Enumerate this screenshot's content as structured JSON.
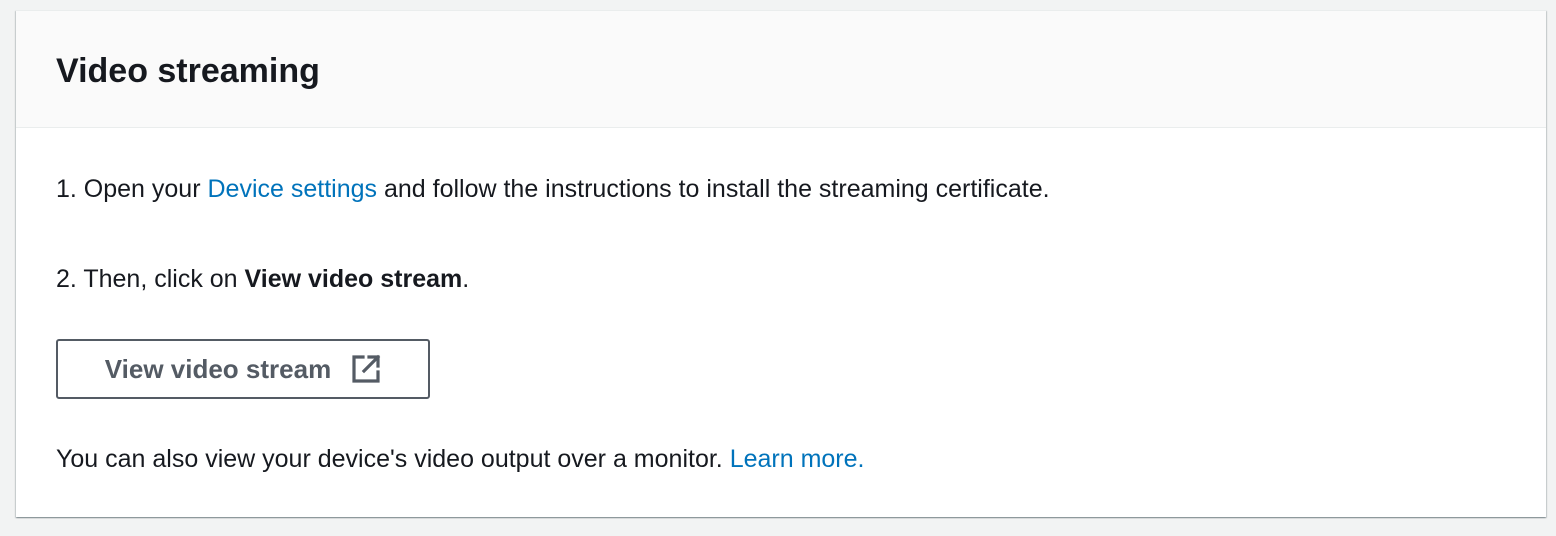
{
  "panel": {
    "title": "Video streaming"
  },
  "steps": {
    "step1": {
      "prefix": "1. Open your ",
      "link": "Device settings",
      "suffix": " and follow the instructions to install the streaming certificate."
    },
    "step2": {
      "prefix": "2. Then, click on ",
      "strong": "View video stream",
      "suffix": "."
    }
  },
  "button": {
    "label": "View video stream",
    "icon": "external-link-icon"
  },
  "note": {
    "text": "You can also view your device's video output over a monitor. ",
    "link": "Learn more."
  },
  "colors": {
    "link": "#0073bb",
    "button_border": "#545b64",
    "header_bg": "#fafafa",
    "page_bg": "#f2f3f3"
  }
}
